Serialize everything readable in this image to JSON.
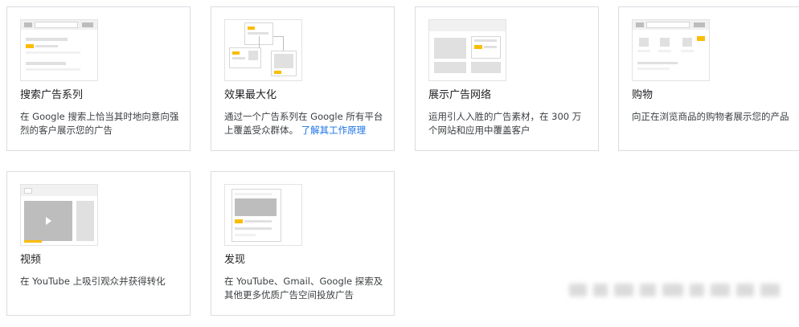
{
  "cards": [
    {
      "title": "搜索广告系列",
      "description": "在 Google 搜索上恰当其时地向意向强烈的客户展示您的广告"
    },
    {
      "title": "效果最大化",
      "description": "通过一个广告系列在 Google 所有平台上覆盖受众群体。",
      "link": "了解其工作原理"
    },
    {
      "title": "展示广告网络",
      "description": "运用引人入胜的广告素材，在 300 万个网站和应用中覆盖客户"
    },
    {
      "title": "购物",
      "description": "向正在浏览商品的购物者展示您的产品"
    },
    {
      "title": "视频",
      "description": "在 YouTube 上吸引观众并获得转化"
    },
    {
      "title": "发现",
      "description": "在 YouTube、Gmail、Google 探索及其他更多优质广告空间投放广告"
    }
  ],
  "colors": {
    "accent_yellow": "#fbbc04",
    "link_blue": "#1a73e8",
    "card_border": "#dadce0"
  },
  "icons": [
    "search-ad-thumbnail",
    "performance-max-thumbnail",
    "display-ad-thumbnail",
    "shopping-thumbnail",
    "video-thumbnail",
    "discovery-thumbnail"
  ]
}
